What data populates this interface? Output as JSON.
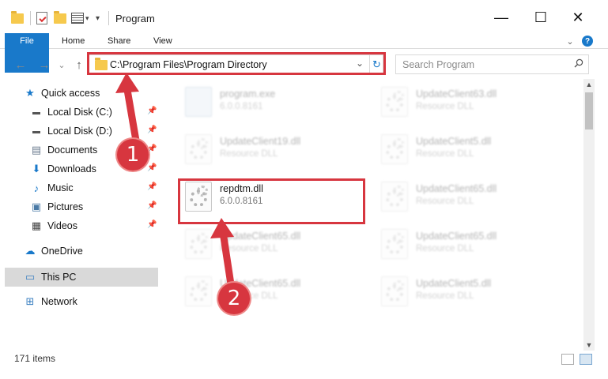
{
  "window": {
    "title": "Program",
    "minimize": "—",
    "maximize": "☐",
    "close": "✕"
  },
  "ribbon": {
    "tabs": [
      "File",
      "Home",
      "Share",
      "View"
    ],
    "expand": "⌄",
    "help": "?"
  },
  "nav": {
    "back": "←",
    "forward": "→",
    "recent": "⌄",
    "up": "↑"
  },
  "address": {
    "path": "C:\\Program Files\\Program Directory",
    "dropdown": "⌄",
    "refresh": "↻"
  },
  "search": {
    "placeholder": "Search Program"
  },
  "sidebar": {
    "items": [
      {
        "label": "Quick access",
        "icon": "star-icon",
        "glyph": "★",
        "color": "#1979ca"
      },
      {
        "label": "Local Disk (C:)",
        "icon": "drive-icon",
        "glyph": "▬",
        "color": "#555555",
        "pinned": true
      },
      {
        "label": "Local Disk (D:)",
        "icon": "drive-icon",
        "glyph": "▬",
        "color": "#555555",
        "pinned": true
      },
      {
        "label": "Documents",
        "icon": "documents-icon",
        "glyph": "▤",
        "color": "#6b7c8f",
        "pinned": true
      },
      {
        "label": "Downloads",
        "icon": "downloads-icon",
        "glyph": "⬇",
        "color": "#1979ca",
        "pinned": true
      },
      {
        "label": "Music",
        "icon": "music-icon",
        "glyph": "♪",
        "color": "#1979ca",
        "pinned": true
      },
      {
        "label": "Pictures",
        "icon": "pictures-icon",
        "glyph": "▣",
        "color": "#4a7aa6",
        "pinned": true
      },
      {
        "label": "Videos",
        "icon": "videos-icon",
        "glyph": "▦",
        "color": "#444444",
        "pinned": true
      },
      {
        "label": "OneDrive",
        "icon": "cloud-icon",
        "glyph": "☁",
        "color": "#1979ca"
      },
      {
        "label": "This PC",
        "icon": "computer-icon",
        "glyph": "▭",
        "color": "#3a7fc1"
      },
      {
        "label": "Network",
        "icon": "network-icon",
        "glyph": "⊞",
        "color": "#3a7fc1"
      }
    ],
    "pin_glyph": "📌"
  },
  "files": [
    {
      "name": "program.exe",
      "detail": "6.0.0.8161"
    },
    {
      "name": "UpdateClient63.dll",
      "detail": "Resource DLL"
    },
    {
      "name": "UpdateClient19.dll",
      "detail": "Resource DLL"
    },
    {
      "name": "UpdateClient5.dll",
      "detail": "Resource DLL"
    },
    {
      "name": "repdtm.dll",
      "detail": "6.0.0.8161"
    },
    {
      "name": "UpdateClient65.dll",
      "detail": "Resource DLL"
    },
    {
      "name": "UpdateClient65.dll",
      "detail": "Resource DLL"
    },
    {
      "name": "UpdateClient65.dll",
      "detail": "Resource DLL"
    },
    {
      "name": "UpdateClient65.dll",
      "detail": "Resource DLL"
    },
    {
      "name": "UpdateClient5.dll",
      "detail": "Resource DLL"
    }
  ],
  "status": {
    "item_count": "171 items"
  },
  "annotations": {
    "step1": "1",
    "step2": "2",
    "color": "#d7363f"
  }
}
